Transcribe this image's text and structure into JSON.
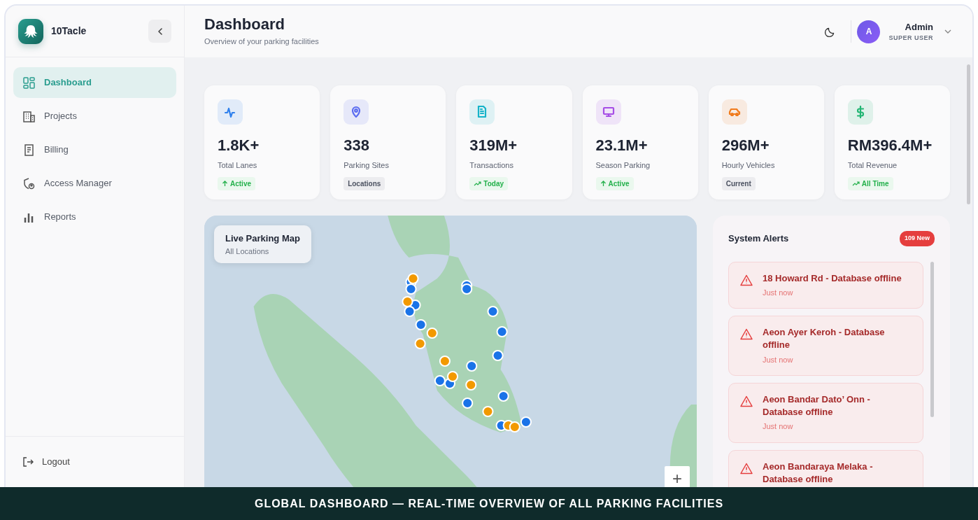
{
  "brand": {
    "name": "10Tacle"
  },
  "sidebar": {
    "items": [
      {
        "label": "Dashboard",
        "selected": true
      },
      {
        "label": "Projects",
        "selected": false
      },
      {
        "label": "Billing",
        "selected": false
      },
      {
        "label": "Access Manager",
        "selected": false
      },
      {
        "label": "Reports",
        "selected": false
      }
    ],
    "logout": "Logout"
  },
  "header": {
    "title": "Dashboard",
    "subtitle": "Overview of your parking facilities",
    "user": {
      "initial": "A",
      "name": "Admin",
      "role": "SUPER USER"
    }
  },
  "stats": [
    {
      "value": "1.8K+",
      "label": "Total Lanes",
      "badge": "Active",
      "kind": "up",
      "color": "#2f80ed"
    },
    {
      "value": "338",
      "label": "Parking Sites",
      "badge": "Locations",
      "kind": "neutral",
      "color": "#5b6cf0"
    },
    {
      "value": "319M+",
      "label": "Transactions",
      "badge": "Today",
      "kind": "trend",
      "color": "#16b3c9"
    },
    {
      "value": "23.1M+",
      "label": "Season Parking",
      "badge": "Active",
      "kind": "up",
      "color": "#a64de6"
    },
    {
      "value": "296M+",
      "label": "Hourly Vehicles",
      "badge": "Current",
      "kind": "neutral",
      "color": "#f07b1d"
    },
    {
      "value": "RM396.4M+",
      "label": "Total Revenue",
      "badge": "All Time",
      "kind": "trend",
      "color": "#22b573"
    }
  ],
  "map": {
    "title": "Live Parking Map",
    "subtitle": "All Locations",
    "zoom_in": "+"
  },
  "alerts": {
    "title": "System Alerts",
    "badge": "109 New",
    "items": [
      {
        "title": "18 Howard Rd - Database offline",
        "time": "Just now"
      },
      {
        "title": "Aeon Ayer Keroh - Database offline",
        "time": "Just now"
      },
      {
        "title": "Aeon Bandar Dato’ Onn - Database offline",
        "time": "Just now"
      },
      {
        "title": "Aeon Bandaraya Melaka - Database offline"
      }
    ]
  },
  "banner": "GLOBAL DASHBOARD — REAL-TIME OVERVIEW OF ALL PARKING FACILITIES"
}
